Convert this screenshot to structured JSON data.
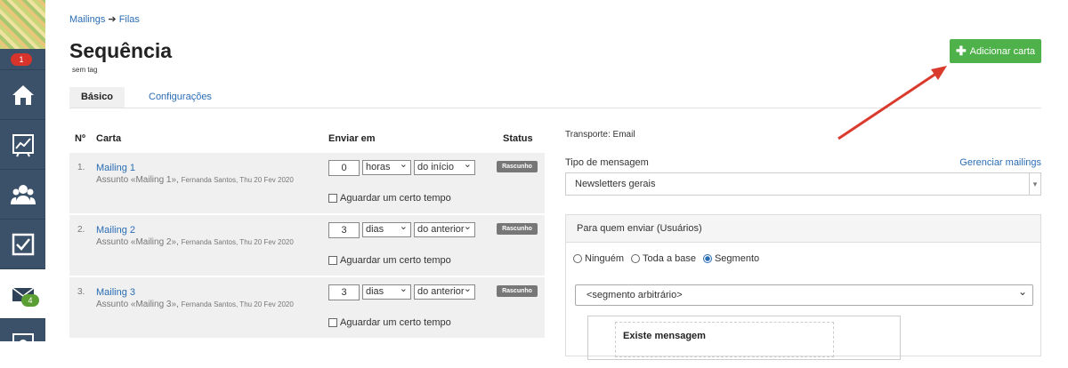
{
  "sidebar": {
    "notifications_badge": "1",
    "mail_badge": "4",
    "items": [
      {
        "icon": "home-icon"
      },
      {
        "icon": "chart-icon"
      },
      {
        "icon": "users-icon"
      },
      {
        "icon": "checkbox-icon"
      },
      {
        "icon": "mail-icon",
        "active": true
      },
      {
        "icon": "settings-icon"
      }
    ]
  },
  "breadcrumb": {
    "parent": "Mailings",
    "separator": "➔",
    "current": "Filas"
  },
  "page": {
    "title": "Sequência",
    "tag": "sem tag",
    "add_button": "Adicionar carta"
  },
  "tabs": [
    {
      "label": "Básico",
      "active": true
    },
    {
      "label": "Configurações",
      "active": false
    }
  ],
  "table": {
    "headers": {
      "num": "Nº",
      "letter": "Carta",
      "send": "Enviar em",
      "status": "Status"
    },
    "rows": [
      {
        "num": "1.",
        "name": "Mailing 1",
        "subject": "Assunto «Mailing 1»,",
        "meta": "Fernanda Santos, Thu 20 Fev 2020",
        "qty": "0",
        "unit": "horas",
        "from": "do início",
        "wait": "Aguardar um certo tempo",
        "status": "Rascunho"
      },
      {
        "num": "2.",
        "name": "Mailing 2",
        "subject": "Assunto «Mailing 2»,",
        "meta": "Fernanda Santos, Thu 20 Fev 2020",
        "qty": "3",
        "unit": "dias",
        "from": "do anterior",
        "wait": "Aguardar um certo tempo",
        "status": "Rascunho"
      },
      {
        "num": "3.",
        "name": "Mailing 3",
        "subject": "Assunto «Mailing 3»,",
        "meta": "Fernanda Santos, Thu 20 Fev 2020",
        "qty": "3",
        "unit": "dias",
        "from": "do anterior",
        "wait": "Aguardar um certo tempo",
        "status": "Rascunho"
      }
    ]
  },
  "right": {
    "transport": "Transporte: Email",
    "message_type_label": "Tipo de mensagem",
    "manage_link": "Gerenciar mailings",
    "message_type_value": "Newsletters gerais",
    "panel_title": "Para quem enviar (Usuários)",
    "radios": [
      {
        "label": "Ninguém",
        "checked": false
      },
      {
        "label": "Toda a base",
        "checked": false
      },
      {
        "label": "Segmento",
        "checked": true
      }
    ],
    "segment_value": "<segmento arbitrário>",
    "exists_label": "Existe mensagem"
  },
  "colors": {
    "sidebar": "#3a5169",
    "accent_green": "#4eb14a",
    "link_blue": "#2a6db5",
    "arrow_red": "#d93a2b"
  }
}
